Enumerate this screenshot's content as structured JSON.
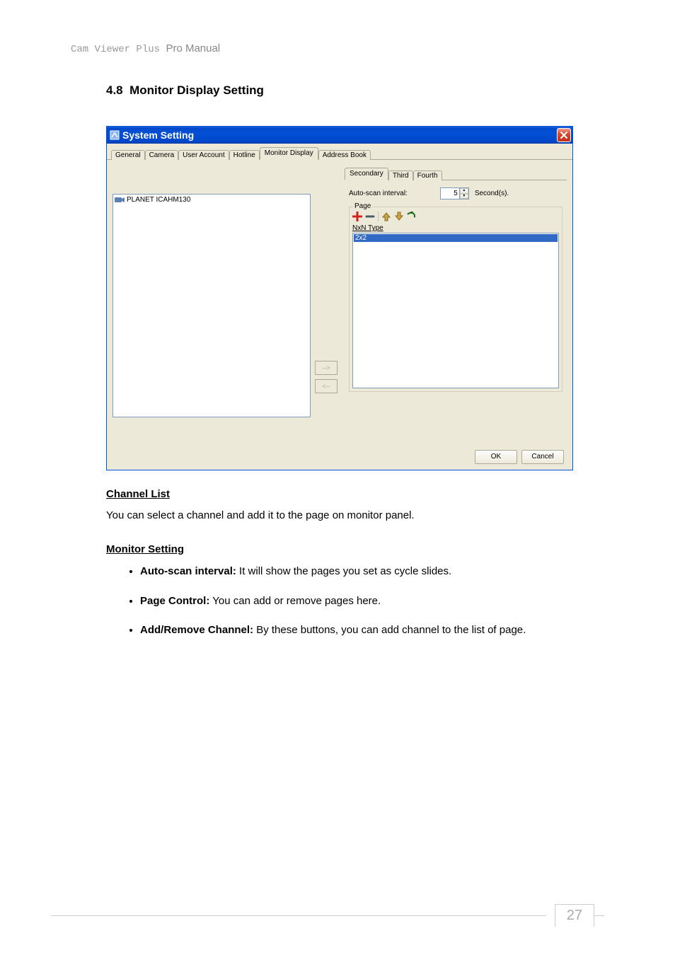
{
  "header": {
    "prefix": "Cam Viewer Plus",
    "suffix": "Pro Manual"
  },
  "section": {
    "number": "4.8",
    "title": "Monitor Display Setting"
  },
  "dialog": {
    "title": "System Setting",
    "outer_tabs": [
      "General",
      "Camera",
      "User Account",
      "Hotline",
      "Monitor Display",
      "Address Book"
    ],
    "outer_active": 4,
    "channel_list_item": "PLANET ICAHM130",
    "arrow_right": "-->",
    "arrow_left": "<--",
    "inner_tabs": [
      "Secondary",
      "Third",
      "Fourth"
    ],
    "inner_active": 0,
    "autoscan_label": "Auto-scan interval:",
    "autoscan_value": "5",
    "autoscan_unit": "Second(s).",
    "page_legend": "Page",
    "nxn_label": "NxN Type",
    "nxn_value": "2x2",
    "ok": "OK",
    "cancel": "Cancel"
  },
  "body": {
    "channel_list_h": "Channel List",
    "channel_list_p": "You can select a channel and add it to the page on monitor panel.",
    "monitor_setting_h": "Monitor Setting",
    "bullets": [
      {
        "b": "Auto-scan interval:",
        "t": " It will show the pages you set as cycle slides."
      },
      {
        "b": "Page Control:",
        "t": " You can add or remove pages here."
      },
      {
        "b": "Add/Remove Channel:",
        "t": " By these buttons, you can add channel to the list of page."
      }
    ]
  },
  "page_number": "27"
}
